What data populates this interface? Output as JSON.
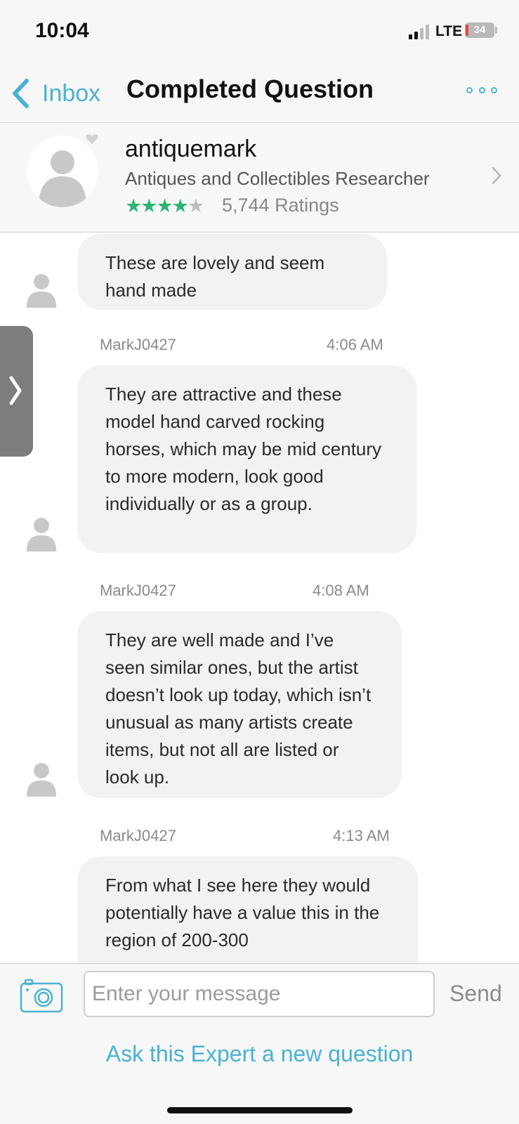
{
  "status_bar": {
    "time": "10:04",
    "network": "LTE",
    "battery": "34"
  },
  "nav": {
    "back_label": "Inbox",
    "title": "Completed Question",
    "more_icon": "more-options-icon"
  },
  "expert": {
    "name": "antiquemark",
    "title": "Antiques and Collectibles Researcher",
    "rating_stars": 4.5,
    "ratings_text": "5,744 Ratings"
  },
  "messages": [
    {
      "author": "",
      "time": "",
      "text": "These are lovely and seem hand made"
    },
    {
      "author": "MarkJ0427",
      "time": "4:06 AM",
      "text": "They are attractive and these model hand carved rocking horses, which may be mid century to more modern, look good individually or as a group."
    },
    {
      "author": "MarkJ0427",
      "time": "4:08 AM",
      "text": "They are well made and I’ve seen similar ones, but the artist doesn’t look up today, which isn’t unusual as many artists create items, but not all are listed or look up."
    },
    {
      "author": "MarkJ0427",
      "time": "4:13 AM",
      "text": "From what I see here they would potentially have a value this in the region of 200-300"
    }
  ],
  "composer": {
    "placeholder": "Enter your message",
    "send_label": "Send"
  },
  "footer": {
    "ask_label": "Ask this Expert a new question"
  },
  "colors": {
    "accent": "#4ab3d1",
    "star": "#2bb573",
    "bubble": "#f2f2f2"
  }
}
